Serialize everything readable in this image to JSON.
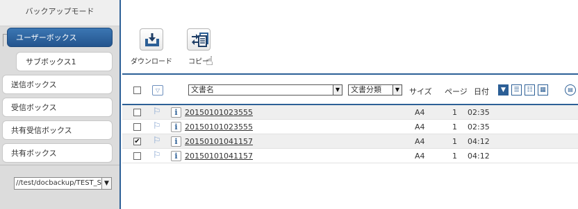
{
  "sidebar": {
    "title": "バックアップモード",
    "items": [
      {
        "label": "ユーザーボックス"
      },
      {
        "label": "サブボックス1"
      },
      {
        "label": "送信ボックス"
      },
      {
        "label": "受信ボックス"
      },
      {
        "label": "共有受信ボックス"
      },
      {
        "label": "共有ボックス"
      }
    ],
    "path_select": "//test/docbackup/TEST_S"
  },
  "toolbar": {
    "download_label": "ダウンロード",
    "copy_label": "コピー"
  },
  "table": {
    "headers": {
      "doc_name": "文書名",
      "category": "文書分類",
      "size": "サイズ",
      "pages": "ページ",
      "date": "日付"
    },
    "rows": [
      {
        "name": "20150101023555",
        "size": "A4",
        "pages": "1",
        "time": "02:35",
        "checked": false
      },
      {
        "name": "20150101023555",
        "size": "A4",
        "pages": "1",
        "time": "02:35",
        "checked": false
      },
      {
        "name": "20150101041157",
        "size": "A4",
        "pages": "1",
        "time": "04:12",
        "checked": true
      },
      {
        "name": "20150101041157",
        "size": "A4",
        "pages": "1",
        "time": "04:12",
        "checked": false
      }
    ]
  },
  "colors": {
    "accent": "#2c5f96",
    "active_item": "#2f6aa6",
    "sidebar_bg": "#dcdcdc",
    "row_alt": "#efefef"
  },
  "icons": {
    "download": "download-tray-icon",
    "copy": "copy-arrows-icon",
    "hand": "hand-pointer-icon",
    "flag": "flag-icon",
    "info": "info-icon"
  }
}
